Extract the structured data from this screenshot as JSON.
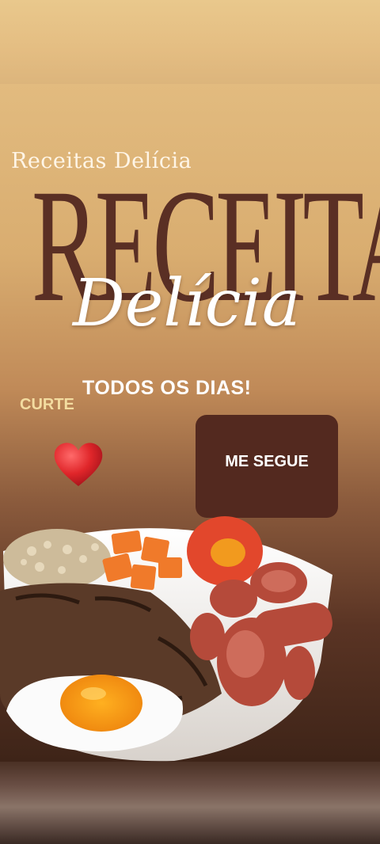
{
  "poster": {
    "small_title": "Receitas Delícia",
    "big_title": "RECEITAS",
    "script_title": "Delícia",
    "tagline": "TODOS OS DIAS!",
    "curte_label": "CURTE",
    "follow_button": "ME SEGUE"
  },
  "icons": {
    "heart": "heart-icon"
  },
  "colors": {
    "big_title": "#5a2f24",
    "follow_button_bg": "#53291f",
    "curte_text": "#f3dca0",
    "heart": "#e0262a"
  }
}
